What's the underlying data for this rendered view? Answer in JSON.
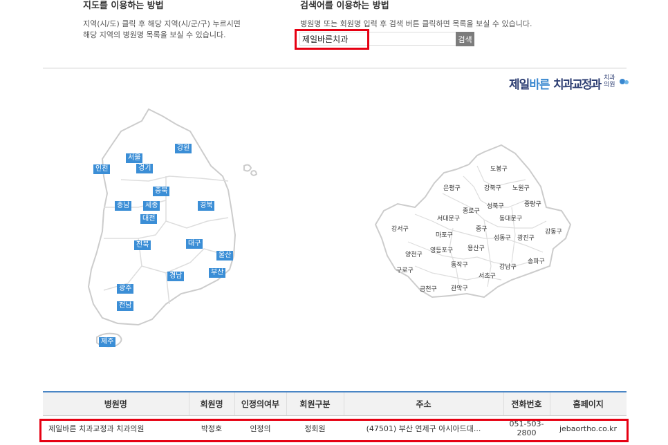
{
  "help": {
    "map": {
      "title": "지도를 이용하는 방법",
      "line1": "지역(시/도) 클릭 후 해당 지역(시/군/구) 누르시면",
      "line2": "해당 지역의 병원명 목록을 보실 수 있습니다."
    },
    "search": {
      "title": "검색어를 이용하는 방법",
      "desc": "병원명 또는 회원명 입력 후 검색 버튼 클릭하면 목록을 보실 수 있습니다."
    }
  },
  "search": {
    "value": "제일바른치과",
    "button_label": "검색"
  },
  "brand": {
    "part1": "제일",
    "part2": "바른",
    "part3": "치과교정과",
    "suffix1": "치과",
    "suffix2": "의원",
    "dot_colors": [
      "#3a88d0",
      "#6fb6e8"
    ]
  },
  "korea_map": {
    "regions": [
      "강원",
      "서울",
      "인천",
      "경기",
      "충북",
      "충남",
      "세종",
      "경북",
      "대전",
      "대구",
      "전북",
      "울산",
      "부산",
      "경남",
      "광주",
      "전남",
      "제주"
    ]
  },
  "seoul_map": {
    "districts": [
      "도봉구",
      "은평구",
      "강북구",
      "노원구",
      "성북구",
      "중랑구",
      "종로구",
      "서대문구",
      "동대문구",
      "강서구",
      "중구",
      "마포구",
      "광진구",
      "성동구",
      "강동구",
      "양천구",
      "영등포구",
      "용산구",
      "송파구",
      "동작구",
      "강남구",
      "구로구",
      "서초구",
      "금천구",
      "관악구"
    ]
  },
  "table": {
    "columns": [
      "병원명",
      "회원명",
      "인정의여부",
      "회원구분",
      "주소",
      "전화번호",
      "홈페이지"
    ],
    "rows": [
      {
        "hospital": "제일바른 치과교정과 치과의원",
        "member": "박정호",
        "certified": "인정의",
        "member_type": "정회원",
        "address": "(47501) 부산 연제구 아시아드대...",
        "phone_line1": "051-503-",
        "phone_line2": "2800",
        "homepage": "jebaortho.co.kr"
      }
    ]
  },
  "colors": {
    "accent": "#3b8ed6",
    "highlight": "#e60012",
    "header_line": "#4a86c5"
  }
}
